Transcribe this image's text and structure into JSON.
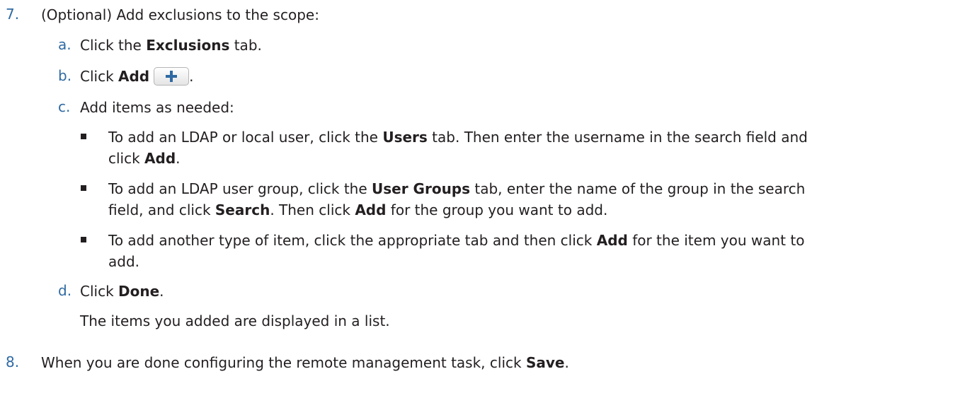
{
  "step7": {
    "number": "7.",
    "text": "(Optional) Add exclusions to the scope:",
    "a": {
      "letter": "a.",
      "pre": "Click the ",
      "bold": "Exclusions",
      "post": " tab."
    },
    "b": {
      "letter": "b.",
      "pre": "Click ",
      "bold": "Add",
      "post": "."
    },
    "c": {
      "letter": "c.",
      "text": "Add items as needed:",
      "bullets": [
        {
          "line1_pre": "To add an LDAP or local user, click the ",
          "line1_bold": "Users",
          "line1_post": " tab. Then enter the username in the search field and",
          "line2_pre": "click ",
          "line2_bold": "Add",
          "line2_post": "."
        },
        {
          "line1_pre": "To add an LDAP user group, click the ",
          "line1_bold": "User Groups",
          "line1_post": " tab, enter the name of the group in the search",
          "line2_pre": "field, and click ",
          "line2_bold": "Search",
          "line2_mid": ". Then click ",
          "line2_bold2": "Add",
          "line2_post": " for the group you want to add."
        },
        {
          "line1_pre": "To add another type of item, click the appropriate tab and then click ",
          "line1_bold": "Add",
          "line1_post": " for the item you want to",
          "line2": "add."
        }
      ]
    },
    "d": {
      "letter": "d.",
      "pre": "Click ",
      "bold": "Done",
      "post": ".",
      "note": "The items you added are displayed in a list."
    }
  },
  "step8": {
    "number": "8.",
    "pre": "When you are done configuring the remote management task, click ",
    "bold": "Save",
    "post": "."
  },
  "icons": {
    "add": "plus-icon"
  },
  "colors": {
    "numbering": "#2f6aa3",
    "text": "#231f20",
    "plus": "#2f6aa3"
  }
}
